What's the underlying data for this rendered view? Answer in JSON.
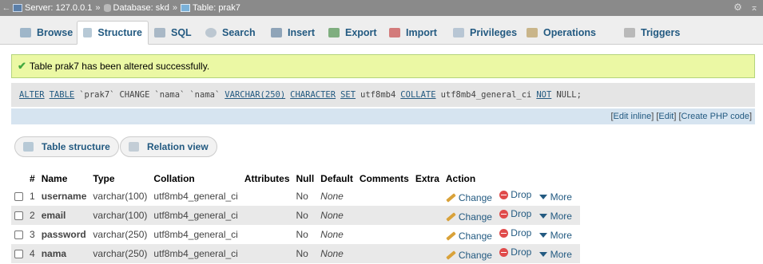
{
  "breadcrumb": {
    "server": "Server: 127.0.0.1",
    "database": "Database: skd",
    "table": "Table: prak7",
    "separator": "»"
  },
  "tabs": [
    {
      "label": "Browse",
      "icon": "browse-icon",
      "active": false
    },
    {
      "label": "Structure",
      "icon": "structure-icon",
      "active": true
    },
    {
      "label": "SQL",
      "icon": "sql-icon",
      "active": false
    },
    {
      "label": "Search",
      "icon": "search-icon",
      "active": false
    },
    {
      "label": "Insert",
      "icon": "insert-icon",
      "active": false
    },
    {
      "label": "Export",
      "icon": "export-icon",
      "active": false
    },
    {
      "label": "Import",
      "icon": "import-icon",
      "active": false
    },
    {
      "label": "Privileges",
      "icon": "privileges-icon",
      "active": false
    },
    {
      "label": "Operations",
      "icon": "operations-icon",
      "active": false
    },
    {
      "label": "Triggers",
      "icon": "triggers-icon",
      "active": false
    }
  ],
  "message": {
    "text": "Table prak7 has been altered successfully."
  },
  "sql": {
    "tokens": [
      {
        "text": "ALTER",
        "kw": true
      },
      {
        "text": "TABLE",
        "kw": true
      },
      {
        "text": "`prak7`",
        "kw": false
      },
      {
        "text": "CHANGE",
        "kw": false
      },
      {
        "text": "`nama`",
        "kw": false
      },
      {
        "text": "`nama`",
        "kw": false
      },
      {
        "text": "VARCHAR(250)",
        "kw": true
      },
      {
        "text": "CHARACTER",
        "kw": true
      },
      {
        "text": "SET",
        "kw": true
      },
      {
        "text": "utf8mb4",
        "kw": false
      },
      {
        "text": "COLLATE",
        "kw": true
      },
      {
        "text": "utf8mb4_general_ci",
        "kw": false
      },
      {
        "text": "NOT",
        "kw": true
      },
      {
        "text": "NULL;",
        "kw": false
      }
    ],
    "edit_inline": "Edit inline",
    "edit": "Edit",
    "create_php": "Create PHP code"
  },
  "subtabs": {
    "table_structure": "Table structure",
    "relation_view": "Relation view"
  },
  "table": {
    "headers": [
      "#",
      "Name",
      "Type",
      "Collation",
      "Attributes",
      "Null",
      "Default",
      "Comments",
      "Extra",
      "Action"
    ],
    "rows": [
      {
        "num": "1",
        "name": "username",
        "type": "varchar(100)",
        "collation": "utf8mb4_general_ci",
        "attributes": "",
        "null": "No",
        "default": "None",
        "comments": "",
        "extra": ""
      },
      {
        "num": "2",
        "name": "email",
        "type": "varchar(100)",
        "collation": "utf8mb4_general_ci",
        "attributes": "",
        "null": "No",
        "default": "None",
        "comments": "",
        "extra": ""
      },
      {
        "num": "3",
        "name": "password",
        "type": "varchar(250)",
        "collation": "utf8mb4_general_ci",
        "attributes": "",
        "null": "No",
        "default": "None",
        "comments": "",
        "extra": ""
      },
      {
        "num": "4",
        "name": "nama",
        "type": "varchar(250)",
        "collation": "utf8mb4_general_ci",
        "attributes": "",
        "null": "No",
        "default": "None",
        "comments": "",
        "extra": ""
      }
    ],
    "actions": {
      "change": "Change",
      "drop": "Drop",
      "more": "More"
    }
  },
  "colors": {
    "link": "#235a81",
    "success_bg": "#ebf8a4",
    "topbar_bg": "#8a8a8a"
  }
}
